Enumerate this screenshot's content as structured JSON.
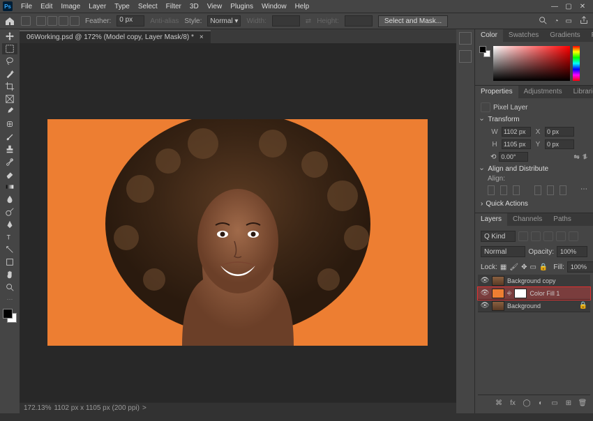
{
  "menu": [
    "File",
    "Edit",
    "Image",
    "Layer",
    "Type",
    "Select",
    "Filter",
    "3D",
    "View",
    "Plugins",
    "Window",
    "Help"
  ],
  "options": {
    "feather_label": "Feather:",
    "feather_value": "0 px",
    "antialias": "Anti-alias",
    "style_label": "Style:",
    "style_value": "Normal",
    "width_label": "Width:",
    "height_label": "Height:",
    "select_mask": "Select and Mask..."
  },
  "doc": {
    "tab": "06Working.psd @ 172% (Model copy, Layer Mask/8) *"
  },
  "status": {
    "zoom": "172.13%",
    "info": "1102 px x 1105 px (200 ppi)",
    "caret": ">"
  },
  "panelTabs": {
    "color": [
      "Color",
      "Swatches",
      "Gradients",
      "Patterns"
    ],
    "props": [
      "Properties",
      "Adjustments",
      "Libraries"
    ],
    "layers": [
      "Layers",
      "Channels",
      "Paths"
    ]
  },
  "properties": {
    "pixel_layer": "Pixel Layer",
    "transform": "Transform",
    "w_label": "W",
    "w_val": "1102 px",
    "x_label": "X",
    "x_val": "0 px",
    "h_label": "H",
    "h_val": "1105 px",
    "y_label": "Y",
    "y_val": "0 px",
    "angle": "0.00°",
    "align": "Align and Distribute",
    "align_label": "Align:",
    "quick": "Quick Actions"
  },
  "layers": {
    "kind": "Kind",
    "blend": "Normal",
    "opacity_label": "Opacity:",
    "opacity": "100%",
    "lock_label": "Lock:",
    "fill_label": "Fill:",
    "fill": "100%",
    "items": [
      {
        "name": "Background copy"
      },
      {
        "name": "Color Fill 1"
      },
      {
        "name": "Background"
      }
    ]
  }
}
